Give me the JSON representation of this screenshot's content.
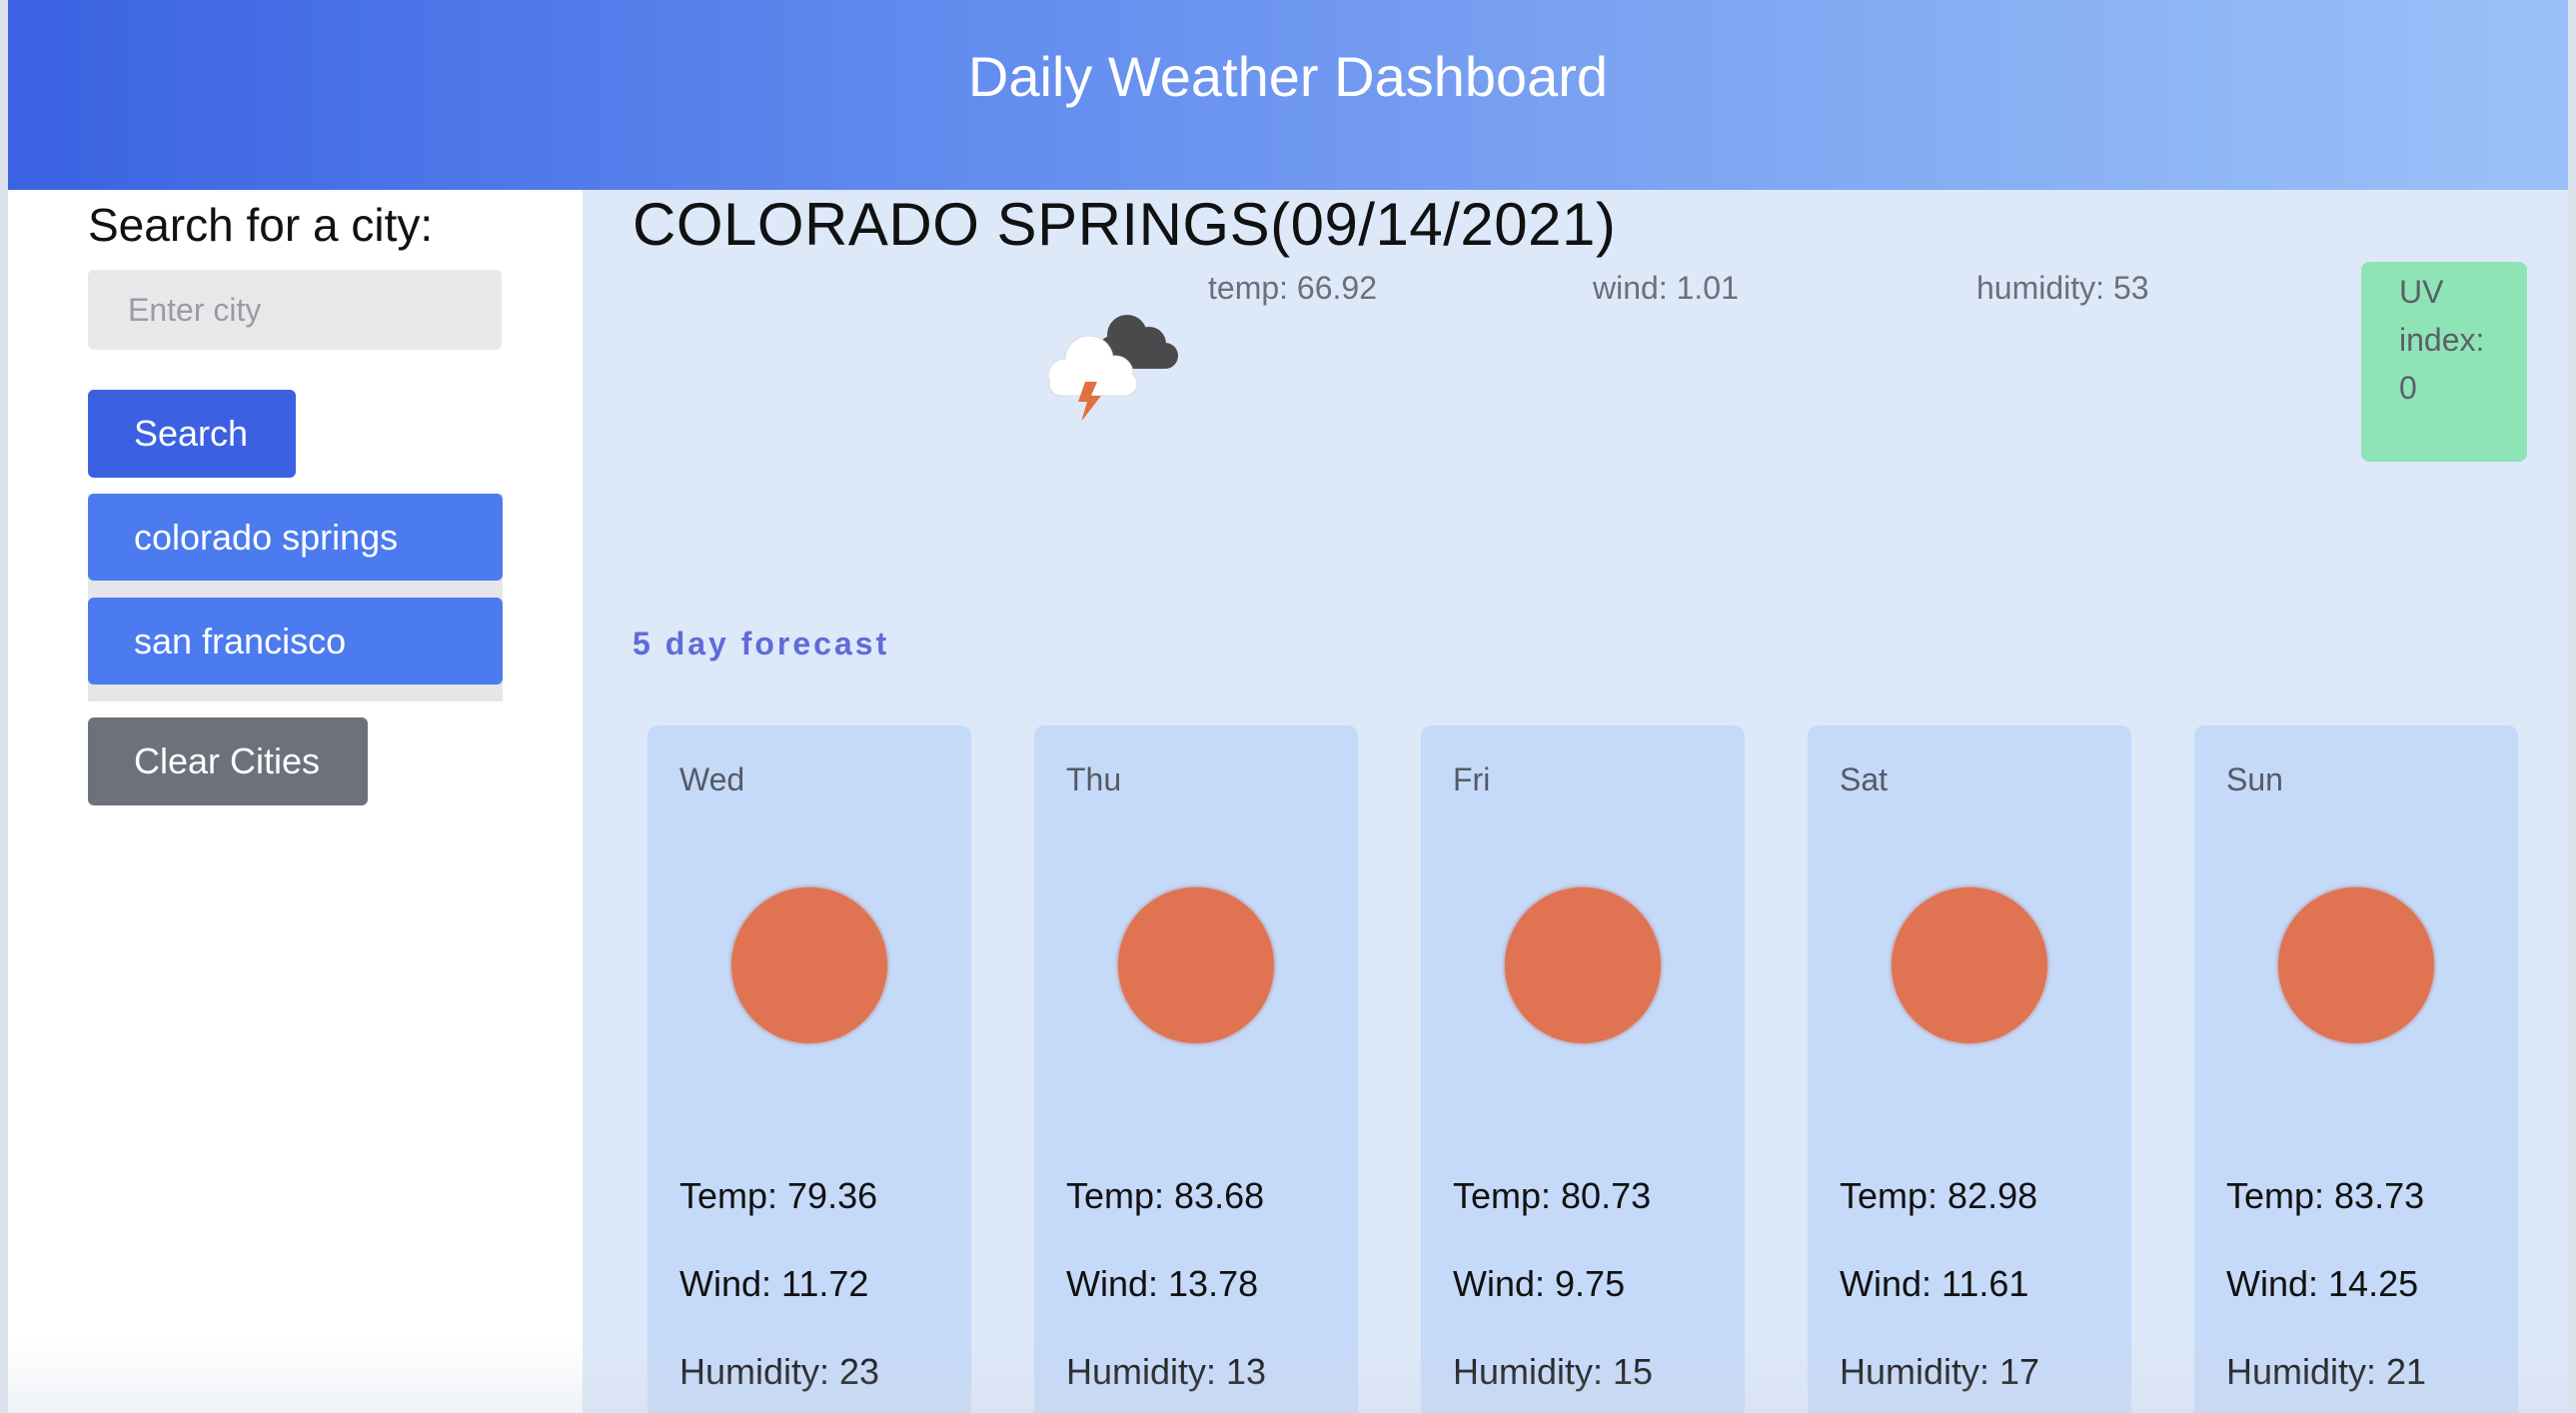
{
  "header": {
    "title": "Daily Weather Dashboard"
  },
  "sidebar": {
    "search_label": "Search for a city:",
    "input_placeholder": "Enter city",
    "input_value": "",
    "search_button": "Search",
    "history": [
      "colorado springs",
      "san francisco"
    ],
    "clear_button": "Clear Cities"
  },
  "current": {
    "title": "COLORADO SPRINGS(09/14/2021)",
    "icon": "thunderstorm-icon",
    "temp": "temp: 66.92",
    "wind": "wind: 1.01",
    "humidity": "humidity: 53",
    "uv_label_1": "UV",
    "uv_label_2": "index:",
    "uv_value": "0"
  },
  "forecast": {
    "label": "5 day forecast",
    "days": [
      {
        "day": "Wed",
        "icon": "sun-icon",
        "temp": "Temp: 79.36",
        "wind": "Wind: 11.72",
        "humidity": "Humidity: 23"
      },
      {
        "day": "Thu",
        "icon": "sun-icon",
        "temp": "Temp: 83.68",
        "wind": "Wind: 13.78",
        "humidity": "Humidity: 13"
      },
      {
        "day": "Fri",
        "icon": "sun-icon",
        "temp": "Temp: 80.73",
        "wind": "Wind: 9.75",
        "humidity": "Humidity: 15"
      },
      {
        "day": "Sat",
        "icon": "sun-icon",
        "temp": "Temp: 82.98",
        "wind": "Wind: 11.61",
        "humidity": "Humidity: 17"
      },
      {
        "day": "Sun",
        "icon": "sun-icon",
        "temp": "Temp: 83.73",
        "wind": "Wind: 14.25",
        "humidity": "Humidity: 21"
      }
    ]
  },
  "colors": {
    "header_start": "#3a62e2",
    "header_end": "#9bc2f8",
    "search_button": "#3b61e2",
    "history_button": "#4b7bef",
    "clear_button": "#6c717c",
    "main_bg": "#dde8f9",
    "card_bg": "#c5d9f8",
    "uv_badge": "#8ee4b7",
    "sun": "#df7352"
  }
}
